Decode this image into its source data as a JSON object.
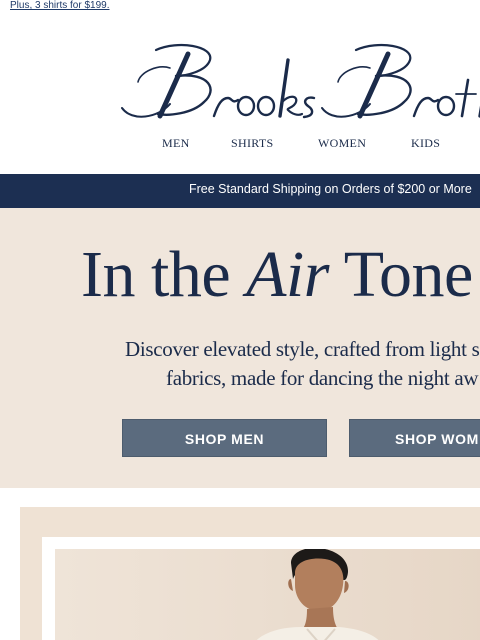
{
  "preheader": {
    "link_text": "Plus, 3 shirts for $199."
  },
  "logo": {
    "text": "Brooks Brothers"
  },
  "nav": {
    "items": [
      "MEN",
      "SHIRTS",
      "WOMEN",
      "KIDS"
    ]
  },
  "shipping_banner": {
    "text": "Free Standard Shipping on Orders of $200 or More"
  },
  "hero": {
    "title_before": "In the ",
    "title_italic": "Air",
    "title_after": " Tone",
    "subtitle_line1": "Discover elevated style, crafted from light s",
    "subtitle_line2": "fabrics, made for dancing the night aw",
    "cta_men": "SHOP MEN",
    "cta_women": "SHOP WOM"
  },
  "colors": {
    "navy": "#1c2f52",
    "hero_bg": "#f0e6dc",
    "button": "#5b6b7e"
  }
}
